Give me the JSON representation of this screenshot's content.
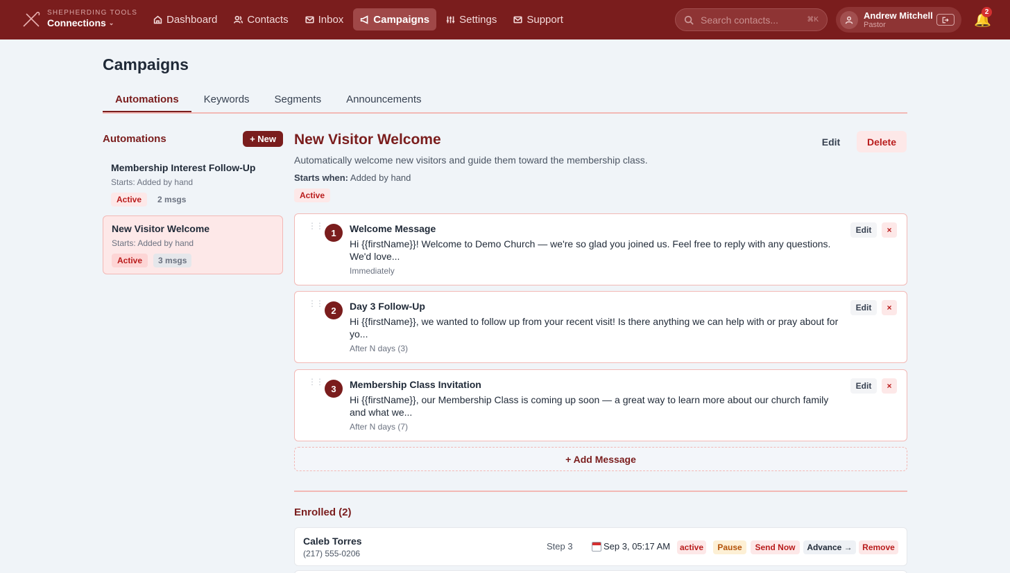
{
  "header": {
    "brand_sub": "SHEPHERDING TOOLS",
    "brand_main": "Connections",
    "nav": [
      {
        "label": "Dashboard",
        "icon": "home-icon"
      },
      {
        "label": "Contacts",
        "icon": "users-icon"
      },
      {
        "label": "Inbox",
        "icon": "mail-icon"
      },
      {
        "label": "Campaigns",
        "icon": "megaphone-icon",
        "active": true
      },
      {
        "label": "Settings",
        "icon": "sliders-icon"
      },
      {
        "label": "Support",
        "icon": "mail-icon"
      }
    ],
    "search_placeholder": "Search contacts...",
    "search_shortcut": "⌘K",
    "user_name": "Andrew Mitchell",
    "user_role": "Pastor",
    "notification_count": "2"
  },
  "page": {
    "title": "Campaigns",
    "tabs": [
      "Automations",
      "Keywords",
      "Segments",
      "Announcements"
    ]
  },
  "left": {
    "title": "Automations",
    "new_label": "+ New",
    "items": [
      {
        "name": "Membership Interest Follow-Up",
        "starts": "Starts: Added by hand",
        "status": "Active",
        "msgs": "2 msgs"
      },
      {
        "name": "New Visitor Welcome",
        "starts": "Starts: Added by hand",
        "status": "Active",
        "msgs": "3 msgs"
      }
    ]
  },
  "detail": {
    "title": "New Visitor Welcome",
    "edit_label": "Edit",
    "delete_label": "Delete",
    "description": "Automatically welcome new visitors and guide them toward the membership class.",
    "starts_label": "Starts when:",
    "starts_value": "Added by hand",
    "status": "Active",
    "steps": [
      {
        "num": "1",
        "title": "Welcome Message",
        "body": "Hi {{firstName}}! Welcome to Demo Church — we're so glad you joined us. Feel free to reply with any questions. We'd love...",
        "timing": "Immediately"
      },
      {
        "num": "2",
        "title": "Day 3 Follow-Up",
        "body": "Hi {{firstName}}, we wanted to follow up from your recent visit! Is there anything we can help with or pray about for yo...",
        "timing": "After N days (3)"
      },
      {
        "num": "3",
        "title": "Membership Class Invitation",
        "body": "Hi {{firstName}}, our Membership Class is coming up soon — a great way to learn more about our church family and what we...",
        "timing": "After N days (7)"
      }
    ],
    "step_edit_label": "Edit",
    "step_remove_label": "×",
    "add_message_label": "+ Add Message",
    "enrolled_title": "Enrolled (2)",
    "enrolled": [
      {
        "name": "Caleb Torres",
        "phone": "(217) 555-0206",
        "step": "Step 3",
        "date": "Sep 3, 05:17 AM",
        "status": "active",
        "pause": "Pause",
        "send": "Send Now",
        "advance": "Advance →",
        "remove": "Remove"
      }
    ]
  },
  "colors": {
    "brand": "#7a1d1d",
    "accent_bg": "#fde8e8",
    "active_text": "#b91c1c"
  }
}
